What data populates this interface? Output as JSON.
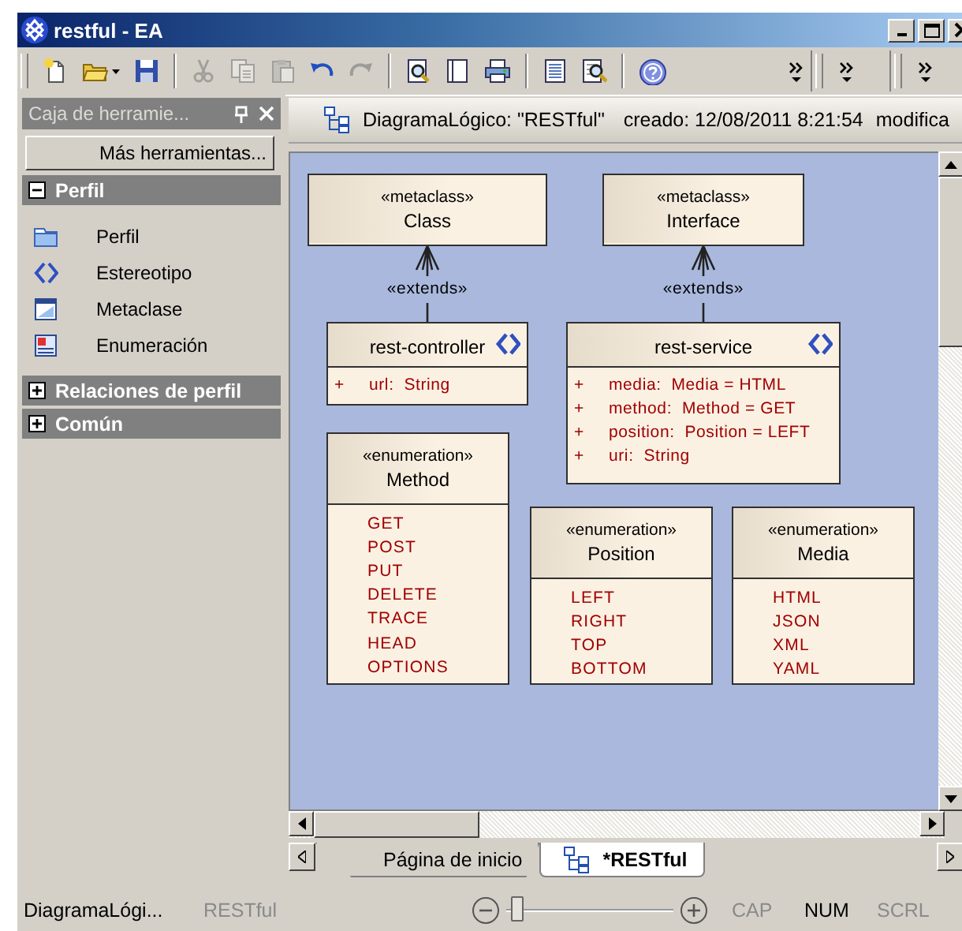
{
  "window": {
    "title": "restful - EA"
  },
  "toolbars": [
    {
      "groups": [
        [
          {
            "kind": "new",
            "disabled": false
          },
          {
            "kind": "open",
            "disabled": false
          },
          {
            "kind": "save",
            "disabled": false
          }
        ],
        [
          {
            "kind": "cut",
            "disabled": true
          },
          {
            "kind": "copy",
            "disabled": true
          },
          {
            "kind": "paste",
            "disabled": true
          },
          {
            "kind": "undo",
            "disabled": false
          },
          {
            "kind": "redo",
            "disabled": true
          }
        ],
        [
          {
            "kind": "find",
            "disabled": false
          },
          {
            "kind": "pages",
            "disabled": false
          },
          {
            "kind": "print",
            "disabled": false
          }
        ],
        [
          {
            "kind": "list",
            "disabled": false
          },
          {
            "kind": "inspect",
            "disabled": false
          }
        ],
        [
          {
            "kind": "help",
            "disabled": false
          }
        ],
        [
          {
            "kind": "overflow",
            "disabled": false
          }
        ]
      ]
    },
    {
      "groups": [
        [
          {
            "kind": "overflow",
            "disabled": false
          }
        ]
      ]
    },
    {
      "groups": [
        [
          {
            "kind": "overflow",
            "disabled": false
          }
        ]
      ]
    }
  ],
  "toolbox": {
    "title": "Caja de herramie...",
    "more_button": "Más herramientas...",
    "sections": [
      {
        "label": "Perfil",
        "expanded": true,
        "items": [
          {
            "label": "Perfil",
            "kind": "profile"
          },
          {
            "label": "Estereotipo",
            "kind": "stereotype"
          },
          {
            "label": "Metaclase",
            "kind": "metaclass"
          },
          {
            "label": "Enumeración",
            "kind": "enumeration"
          }
        ]
      },
      {
        "label": "Relaciones de perfil",
        "expanded": false
      },
      {
        "label": "Común",
        "expanded": false
      }
    ]
  },
  "diagram": {
    "header": {
      "name": "DiagramaLógico: \"RESTful\"",
      "created": "creado: 12/08/2011 8:21:54",
      "modified": "modifica"
    },
    "elements": [
      {
        "kind": "metaclass",
        "stereotype": "«metaclass»",
        "name": "Class"
      },
      {
        "kind": "metaclass",
        "stereotype": "«metaclass»",
        "name": "Interface"
      },
      {
        "kind": "stereotype",
        "name": "rest-controller",
        "attributes": [
          {
            "visibility": "+",
            "text": "url:  String"
          }
        ]
      },
      {
        "kind": "stereotype",
        "name": "rest-service",
        "attributes": [
          {
            "visibility": "+",
            "text": "media:  Media = HTML"
          },
          {
            "visibility": "+",
            "text": "method:  Method = GET"
          },
          {
            "visibility": "+",
            "text": "position:  Position = LEFT"
          },
          {
            "visibility": "+",
            "text": "uri:  String"
          }
        ]
      },
      {
        "kind": "enumeration",
        "stereotype": "«enumeration»",
        "name": "Method",
        "literals": [
          "GET",
          "POST",
          "PUT",
          "DELETE",
          "TRACE",
          "HEAD",
          "OPTIONS"
        ]
      },
      {
        "kind": "enumeration",
        "stereotype": "«enumeration»",
        "name": "Position",
        "literals": [
          "LEFT",
          "RIGHT",
          "TOP",
          "BOTTOM"
        ]
      },
      {
        "kind": "enumeration",
        "stereotype": "«enumeration»",
        "name": "Media",
        "literals": [
          "HTML",
          "JSON",
          "XML",
          "YAML"
        ]
      }
    ],
    "connectors": [
      {
        "label": "«extends»"
      },
      {
        "label": "«extends»"
      }
    ]
  },
  "tabs": [
    {
      "label": "Página de inicio",
      "selected": false
    },
    {
      "label": "*RESTful",
      "selected": true
    }
  ],
  "status_bar": {
    "diagram": "DiagramaLógi...",
    "package": "RESTful",
    "zoom": {
      "level": 0.03
    },
    "indicators": [
      {
        "label": "CAP",
        "active": false
      },
      {
        "label": "NUM",
        "active": true
      },
      {
        "label": "SCRL",
        "active": false
      }
    ]
  }
}
